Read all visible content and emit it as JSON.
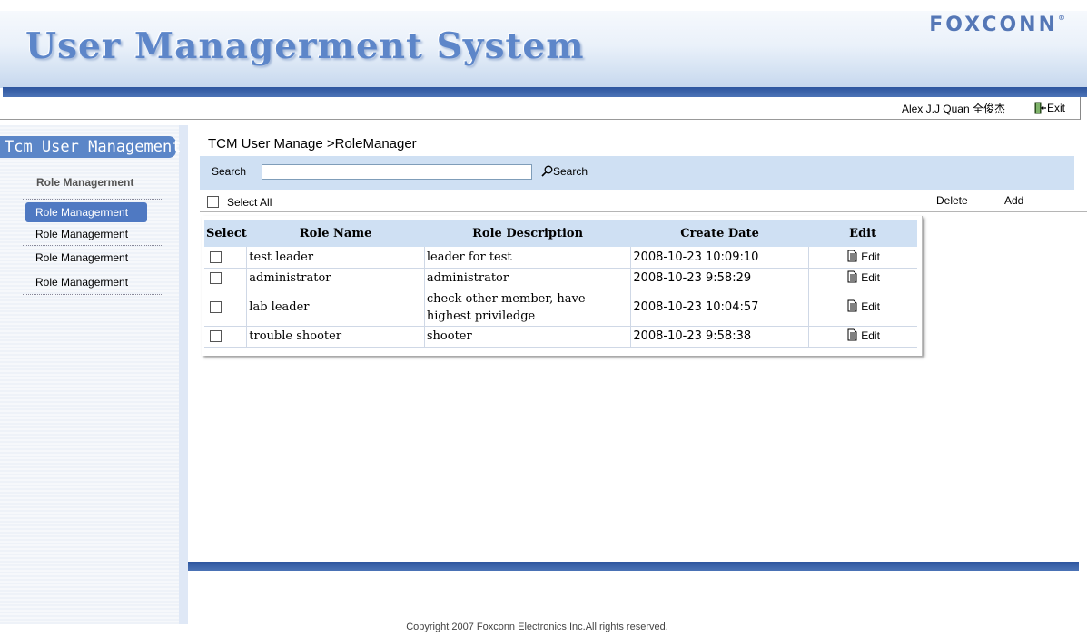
{
  "header": {
    "title": "User Managerment System",
    "brand": "FOXCONN",
    "brand_mark": "®"
  },
  "user_strip": {
    "user_name": "Alex J.J Quan 全俊杰",
    "exit_label": "Exit"
  },
  "sidebar": {
    "title": "Tcm User Management",
    "section_label": "Role Managerment",
    "items": [
      {
        "label": "Role Managerment"
      },
      {
        "label": "Role Managerment"
      },
      {
        "label": "Role Managerment"
      },
      {
        "label": "Role Managerment"
      }
    ]
  },
  "main": {
    "breadcrumb": "TCM User Manage >RoleManager",
    "search": {
      "label": "Search",
      "value": "",
      "placeholder": "",
      "button_label": "Search"
    },
    "actions": {
      "select_all_label": "Select All",
      "delete_label": "Delete",
      "add_label": "Add"
    },
    "table": {
      "columns": [
        "Select",
        "Role Name",
        "Role Description",
        "Create Date",
        "Edit"
      ],
      "rows": [
        {
          "name": "test leader",
          "description": "leader for test",
          "date": "2008-10-23 10:09:10",
          "edit": "Edit"
        },
        {
          "name": "administrator",
          "description": "administrator",
          "date": "2008-10-23 9:58:29",
          "edit": "Edit"
        },
        {
          "name": "lab leader",
          "description": "check other member, have highest priviledge",
          "date": "2008-10-23 10:04:57",
          "edit": "Edit"
        },
        {
          "name": "trouble shooter",
          "description": "shooter",
          "date": "2008-10-23 9:58:38",
          "edit": "Edit"
        }
      ]
    }
  },
  "footer": {
    "copyright": "Copyright 2007 Foxconn Electronics Inc.All rights reserved."
  },
  "icons": {
    "exit": "exit-door-icon",
    "search": "magnifier-icon",
    "edit": "document-edit-icon"
  },
  "colors": {
    "accent_blue": "#4f79c2",
    "header_bar": "#2e569f",
    "search_bar_bg": "#cfe0f3",
    "title_blue": "#5d86c9"
  }
}
